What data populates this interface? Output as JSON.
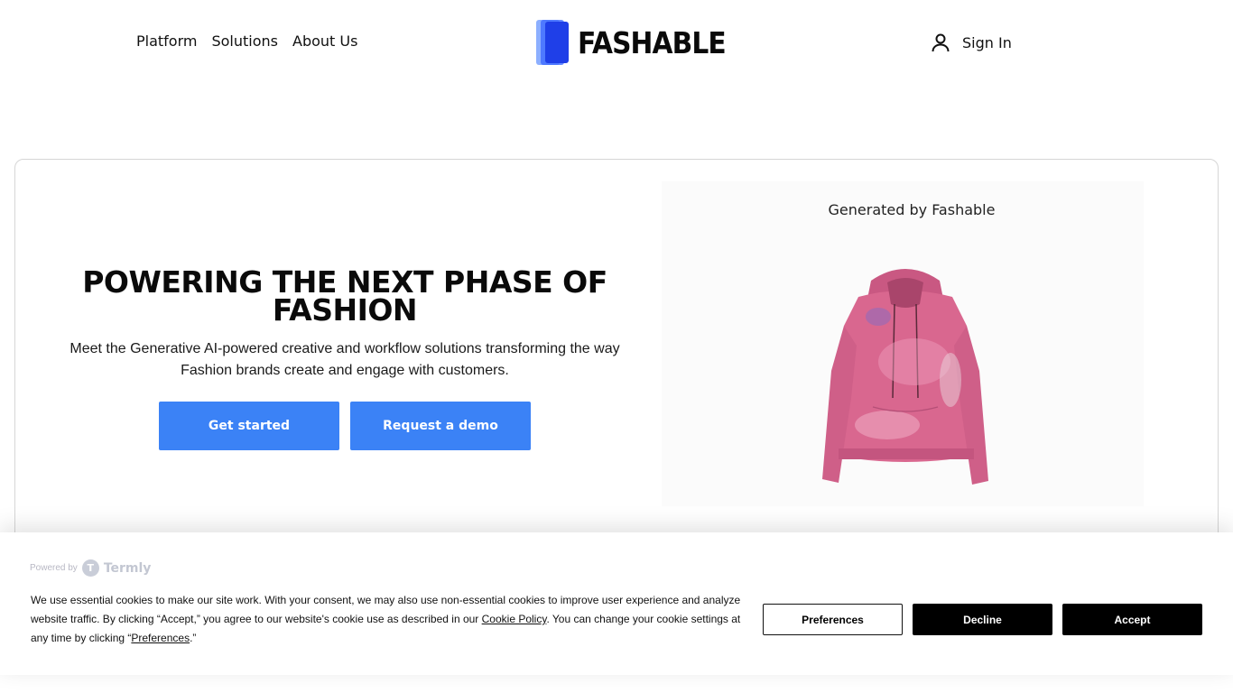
{
  "nav": {
    "links": [
      "Platform",
      "Solutions",
      "About Us"
    ],
    "logo_text": "FASHABLE",
    "signin_label": "Sign In"
  },
  "hero": {
    "title": "POWERING THE NEXT PHASE OF FASHION",
    "subtitle": "Meet the Generative AI-powered creative and workflow solutions transforming the way Fashion brands create and engage with customers.",
    "primary_button": "Get started",
    "secondary_button": "Request a demo",
    "image_caption": "Generated by Fashable"
  },
  "cookie": {
    "powered_by": "Powered by",
    "brand": "Termly",
    "text_part1": "We use essential cookies to make our site work. With your consent, we may also use non-essential cookies to improve user experience and analyze website traffic. By clicking “Accept,” you agree to our website's cookie use as described in our ",
    "cookie_policy_link": "Cookie Policy",
    "text_part2": ". You can change your cookie settings at any time by clicking “",
    "preferences_link": "Preferences",
    "text_part3": ".”",
    "preferences_button": "Preferences",
    "decline_button": "Decline",
    "accept_button": "Accept"
  },
  "colors": {
    "accent": "#3b82f6",
    "hoodie": "#d9678f",
    "logo_blue": "#2f57f5"
  },
  "icons": {
    "user": "user-icon",
    "logo": "fashable-logo-icon",
    "termly": "termly-logo-icon"
  }
}
